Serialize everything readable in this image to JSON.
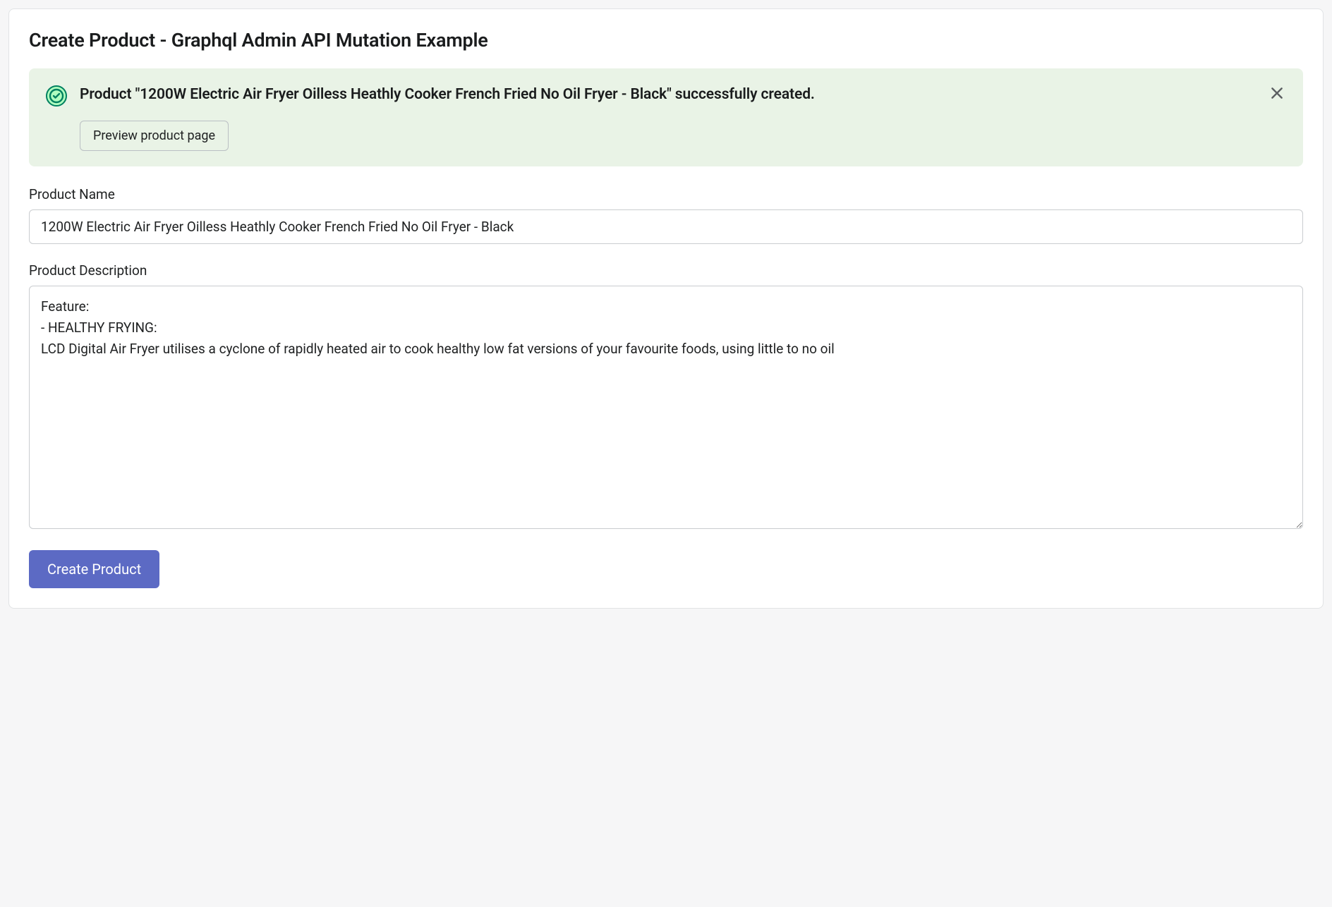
{
  "header": {
    "title": "Create Product - Graphql Admin API Mutation Example"
  },
  "banner": {
    "message": "Product \"1200W Electric Air Fryer Oilless Heathly Cooker French Fried No Oil Fryer - Black\" successfully created.",
    "action_label": "Preview product page"
  },
  "form": {
    "product_name": {
      "label": "Product Name",
      "value": "1200W Electric Air Fryer Oilless Heathly Cooker French Fried No Oil Fryer - Black"
    },
    "product_description": {
      "label": "Product Description",
      "value": "Feature:\n- HEALTHY FRYING:\nLCD Digital Air Fryer utilises a cyclone of rapidly heated air to cook healthy low fat versions of your favourite foods, using little to no oil"
    },
    "submit_label": "Create Product"
  }
}
